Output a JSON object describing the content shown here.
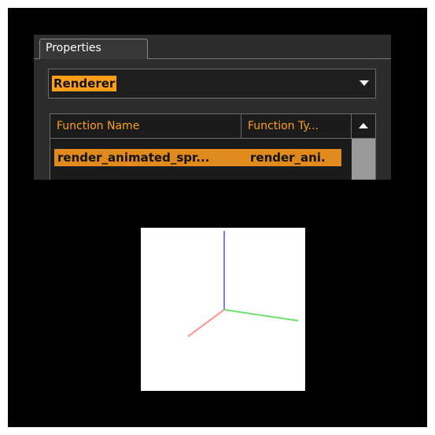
{
  "panel": {
    "tab_label": "Properties",
    "dropdown": {
      "selected": "Renderer"
    },
    "table": {
      "columns": [
        "Function Name",
        "Function Ty..."
      ],
      "rows": [
        {
          "name": "render_animated_spr...",
          "type": "render_ani."
        }
      ]
    }
  },
  "colors": {
    "accent": "#ff9e1b",
    "selected_row": "#e08a1d",
    "panel_bg": "#2d2d2d",
    "background": "#000000"
  },
  "viewport": {
    "axes": [
      "x-axis-green",
      "y-axis-blue",
      "z-axis-red"
    ]
  }
}
